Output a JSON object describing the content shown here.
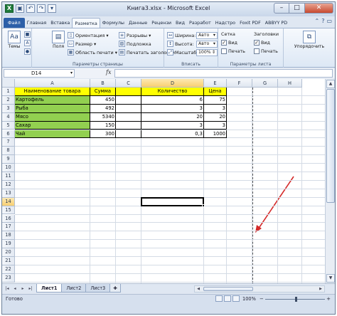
{
  "window": {
    "title": "Книга3.xlsx - Microsoft Excel",
    "qat": [
      "excel-logo-icon",
      "save-icon",
      "undo-icon",
      "redo-icon",
      "customize-icon"
    ],
    "controls": {
      "minimize": "–",
      "maximize": "□",
      "close": "✕"
    }
  },
  "ribbon": {
    "tabs": [
      "Файл",
      "Главная",
      "Вставка",
      "Разметка",
      "Формулы",
      "Данные",
      "Рецензи",
      "Вид",
      "Разработ",
      "Надстро",
      "Foxit PDF",
      "ABBYY PD"
    ],
    "active_tab": "Разметка",
    "themes": {
      "label": "Темы"
    },
    "page_setup": {
      "fields": "Поля",
      "orientation": "Ориентация",
      "size": "Размер",
      "print_area": "Область печати",
      "breaks": "Разрывы",
      "background": "Подложка",
      "print_titles": "Печатать заголовки",
      "group_label": "Параметры страницы"
    },
    "fit": {
      "width_label": "Ширина:",
      "width_value": "Авто",
      "height_label": "Высота:",
      "height_value": "Авто",
      "scale_label": "Масштаб:",
      "scale_value": "100%",
      "group_label": "Вписать"
    },
    "sheet_options": {
      "gridlines": "Сетка",
      "headings": "Заголовки",
      "view": "Вид",
      "print": "Печать",
      "group_label": "Параметры листа"
    },
    "arrange": {
      "label": "Упорядочить"
    }
  },
  "formula_bar": {
    "name_box": "D14",
    "fx": "fx",
    "value": ""
  },
  "grid": {
    "columns": [
      "A",
      "B",
      "C",
      "D",
      "E",
      "F",
      "G",
      "H"
    ],
    "rows": [
      "1",
      "2",
      "3",
      "4",
      "5",
      "6",
      "7",
      "8",
      "9",
      "10",
      "11",
      "12",
      "13",
      "14",
      "15",
      "16",
      "17",
      "18",
      "19",
      "20",
      "21",
      "22",
      "23"
    ],
    "selected_column": "D",
    "selected_row": "14",
    "headers": {
      "name": "Наименование товара",
      "sum": "Сумма",
      "qty": "Количество",
      "price": "Цена"
    },
    "data": [
      {
        "name": "Картофель",
        "sum": "450",
        "qty": "6",
        "price": "75"
      },
      {
        "name": "Рыба",
        "sum": "492",
        "qty": "3",
        "price": "3"
      },
      {
        "name": "Мясо",
        "sum": "5340",
        "qty": "20",
        "price": "20"
      },
      {
        "name": "Сахар",
        "sum": "150",
        "qty": "3",
        "price": "3"
      },
      {
        "name": "Чай",
        "sum": "300",
        "qty": "0,3",
        "price": "1000"
      }
    ]
  },
  "sheets": {
    "tabs": [
      "Лист1",
      "Лист2",
      "Лист3"
    ],
    "active": "Лист1"
  },
  "status": {
    "ready": "Готово",
    "zoom": "100%",
    "zoom_minus": "−",
    "zoom_plus": "+"
  }
}
